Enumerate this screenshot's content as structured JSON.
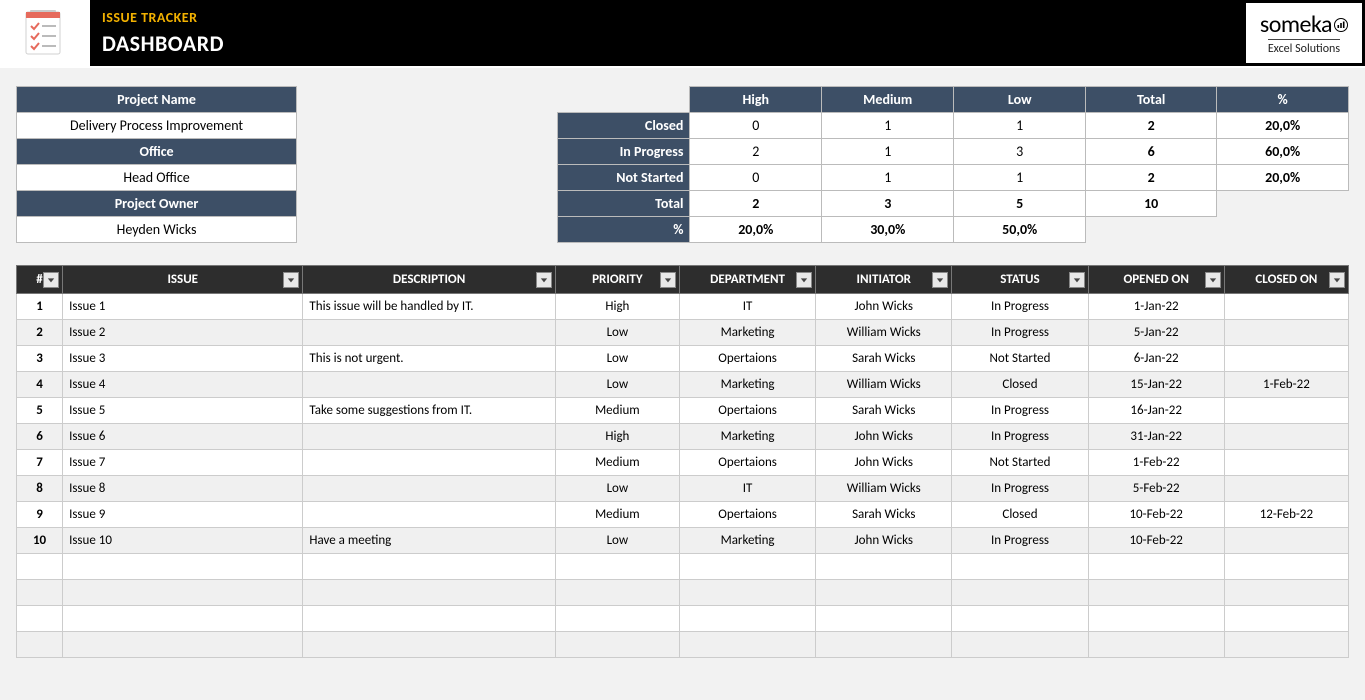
{
  "header": {
    "small": "ISSUE TRACKER",
    "big": "DASHBOARD",
    "brand_top": "someka",
    "brand_sub": "Excel Solutions"
  },
  "info": {
    "project_name_label": "Project Name",
    "project_name": "Delivery Process Improvement",
    "office_label": "Office",
    "office": "Head Office",
    "owner_label": "Project Owner",
    "owner": "Heyden Wicks"
  },
  "summary": {
    "cols": [
      "High",
      "Medium",
      "Low",
      "Total",
      "%"
    ],
    "rows": [
      {
        "label": "Closed",
        "cells": [
          "0",
          "1",
          "1",
          "2",
          "20,0%"
        ]
      },
      {
        "label": "In Progress",
        "cells": [
          "2",
          "1",
          "3",
          "6",
          "60,0%"
        ]
      },
      {
        "label": "Not Started",
        "cells": [
          "0",
          "1",
          "1",
          "2",
          "20,0%"
        ]
      },
      {
        "label": "Total",
        "cells": [
          "2",
          "3",
          "5",
          "10",
          ""
        ]
      },
      {
        "label": "%",
        "cells": [
          "20,0%",
          "30,0%",
          "50,0%",
          "",
          ""
        ]
      }
    ]
  },
  "issues": {
    "headers": [
      "#",
      "ISSUE",
      "DESCRIPTION",
      "PRIORITY",
      "DEPARTMENT",
      "INITIATOR",
      "STATUS",
      "OPENED ON",
      "CLOSED ON"
    ],
    "rows": [
      {
        "n": "1",
        "issue": "Issue 1",
        "desc": "This issue will be handled by IT.",
        "prio": "High",
        "dept": "IT",
        "init": "John Wicks",
        "status": "In Progress",
        "open": "1-Jan-22",
        "close": ""
      },
      {
        "n": "2",
        "issue": "Issue 2",
        "desc": "",
        "prio": "Low",
        "dept": "Marketing",
        "init": "William Wicks",
        "status": "In Progress",
        "open": "5-Jan-22",
        "close": ""
      },
      {
        "n": "3",
        "issue": "Issue 3",
        "desc": "This is not urgent.",
        "prio": "Low",
        "dept": "Opertaions",
        "init": "Sarah  Wicks",
        "status": "Not Started",
        "open": "6-Jan-22",
        "close": ""
      },
      {
        "n": "4",
        "issue": "Issue 4",
        "desc": "",
        "prio": "Low",
        "dept": "Marketing",
        "init": "William Wicks",
        "status": "Closed",
        "open": "15-Jan-22",
        "close": "1-Feb-22"
      },
      {
        "n": "5",
        "issue": "Issue 5",
        "desc": "Take some suggestions from IT.",
        "prio": "Medium",
        "dept": "Opertaions",
        "init": "Sarah  Wicks",
        "status": "In Progress",
        "open": "16-Jan-22",
        "close": ""
      },
      {
        "n": "6",
        "issue": "Issue 6",
        "desc": "",
        "prio": "High",
        "dept": "Marketing",
        "init": "John Wicks",
        "status": "In Progress",
        "open": "31-Jan-22",
        "close": ""
      },
      {
        "n": "7",
        "issue": "Issue 7",
        "desc": "",
        "prio": "Medium",
        "dept": "Opertaions",
        "init": "John Wicks",
        "status": "Not Started",
        "open": "1-Feb-22",
        "close": ""
      },
      {
        "n": "8",
        "issue": "Issue 8",
        "desc": "",
        "prio": "Low",
        "dept": "IT",
        "init": "William Wicks",
        "status": "In Progress",
        "open": "5-Feb-22",
        "close": ""
      },
      {
        "n": "9",
        "issue": "Issue 9",
        "desc": "",
        "prio": "Medium",
        "dept": "Opertaions",
        "init": "Sarah  Wicks",
        "status": "Closed",
        "open": "10-Feb-22",
        "close": "12-Feb-22"
      },
      {
        "n": "10",
        "issue": "Issue 10",
        "desc": "Have a meeting",
        "prio": "Low",
        "dept": "Marketing",
        "init": "John Wicks",
        "status": "In Progress",
        "open": "10-Feb-22",
        "close": ""
      }
    ],
    "blank_rows": 4
  },
  "chart_data": {
    "type": "table",
    "title": "Issue counts by Status and Priority",
    "columns": [
      "High",
      "Medium",
      "Low",
      "Total",
      "%"
    ],
    "rows": [
      "Closed",
      "In Progress",
      "Not Started",
      "Total",
      "%"
    ],
    "values": [
      [
        0,
        1,
        1,
        2,
        "20,0%"
      ],
      [
        2,
        1,
        3,
        6,
        "60,0%"
      ],
      [
        0,
        1,
        1,
        2,
        "20,0%"
      ],
      [
        2,
        3,
        5,
        10,
        null
      ],
      [
        "20,0%",
        "30,0%",
        "50,0%",
        null,
        null
      ]
    ]
  }
}
